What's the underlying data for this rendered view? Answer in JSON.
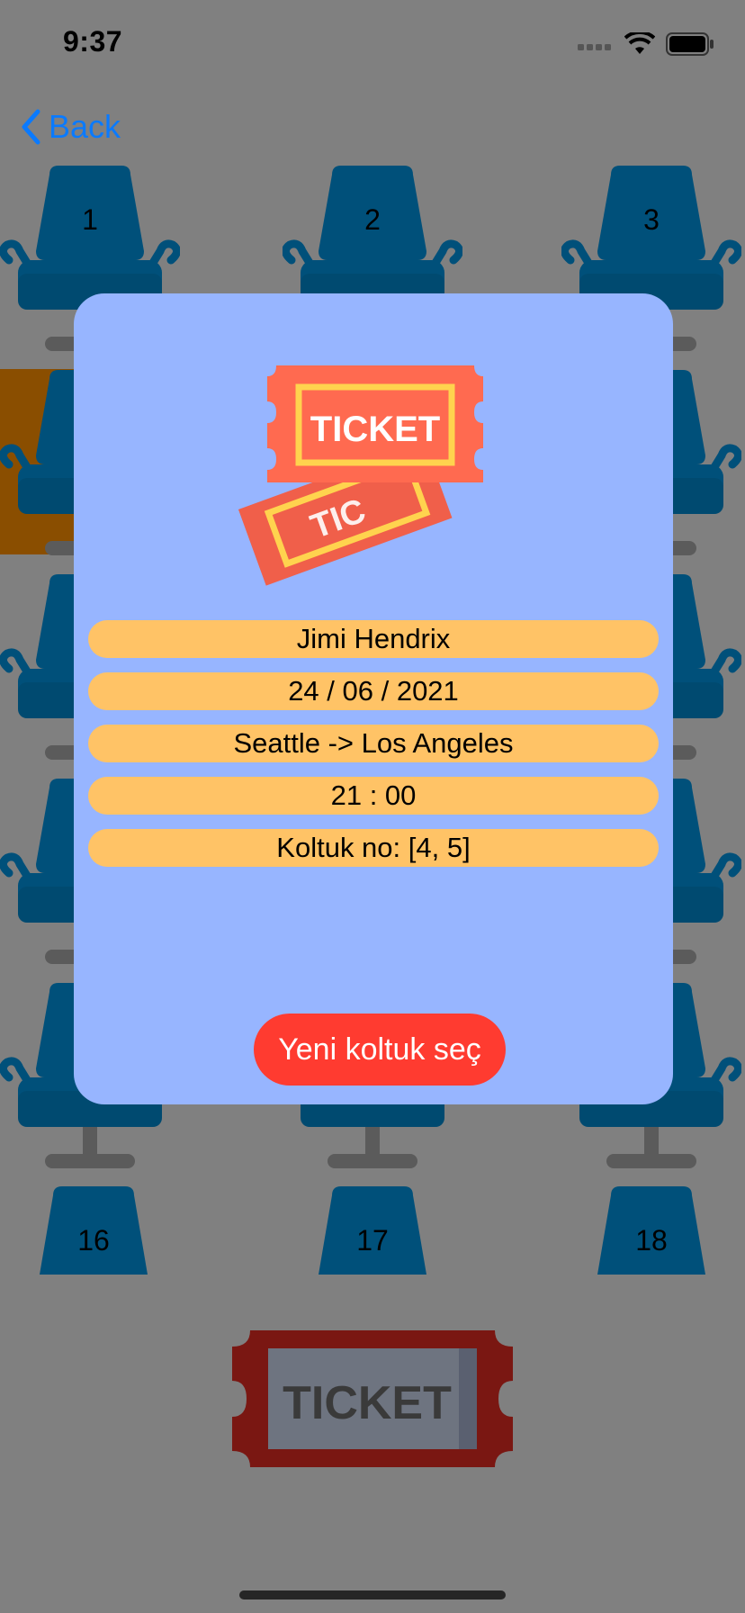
{
  "status_bar": {
    "time": "9:37"
  },
  "nav": {
    "back_label": "Back"
  },
  "seats": {
    "row1": [
      "1",
      "2",
      "3"
    ],
    "row_last": [
      "16",
      "17",
      "18"
    ]
  },
  "bottom_ticket": {
    "label": "TICKET"
  },
  "modal": {
    "art_label": "TICKET",
    "name": "Jimi Hendrix",
    "date": "24 / 06 / 2021",
    "route": "Seattle -> Los Angeles",
    "time": "21 : 00",
    "seat_info": "Koltuk no: [4, 5]",
    "button_label": "Yeni koltuk seç"
  },
  "colors": {
    "backdrop": "#808080",
    "seat_blue": "#00507A",
    "modal_bg": "#97B5FF",
    "pill_bg": "#FFC366",
    "button_red": "#FF3B30",
    "selected_seat": "#8A4E00",
    "link_blue": "#0A7AFF"
  }
}
